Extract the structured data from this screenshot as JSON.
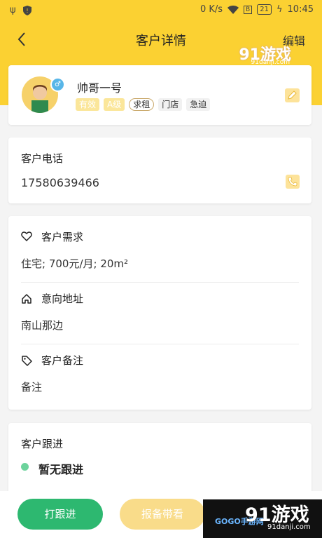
{
  "status_bar": {
    "speed": "0 K/s",
    "battery": "21",
    "time": "10:45"
  },
  "header": {
    "title": "客户详情",
    "edit": "编辑"
  },
  "watermark": {
    "top": "91游戏",
    "top_url": "91danji.com",
    "bottom": "91游戏",
    "bottom_url": "91danji.com",
    "gogo": "GOGO手游网"
  },
  "customer": {
    "name": "帅哥一号",
    "gender_symbol": "♂",
    "tags": [
      "有效",
      "A级",
      "求租",
      "门店",
      "急迫"
    ]
  },
  "phone": {
    "label": "客户电话",
    "number": "17580639466"
  },
  "requirement": {
    "label": "客户需求",
    "value": "住宅; 700元/月; 20m²"
  },
  "address": {
    "label": "意向地址",
    "value": "南山那边"
  },
  "remark": {
    "label": "客户备注",
    "value": "备注"
  },
  "follow": {
    "label": "客户跟进",
    "status": "暂无跟进"
  },
  "buttons": {
    "follow": "打跟进",
    "report": "报备带看"
  },
  "colors": {
    "brand_yellow": "#fbd132",
    "green": "#2db870",
    "light_yellow": "#f9dc8a"
  }
}
